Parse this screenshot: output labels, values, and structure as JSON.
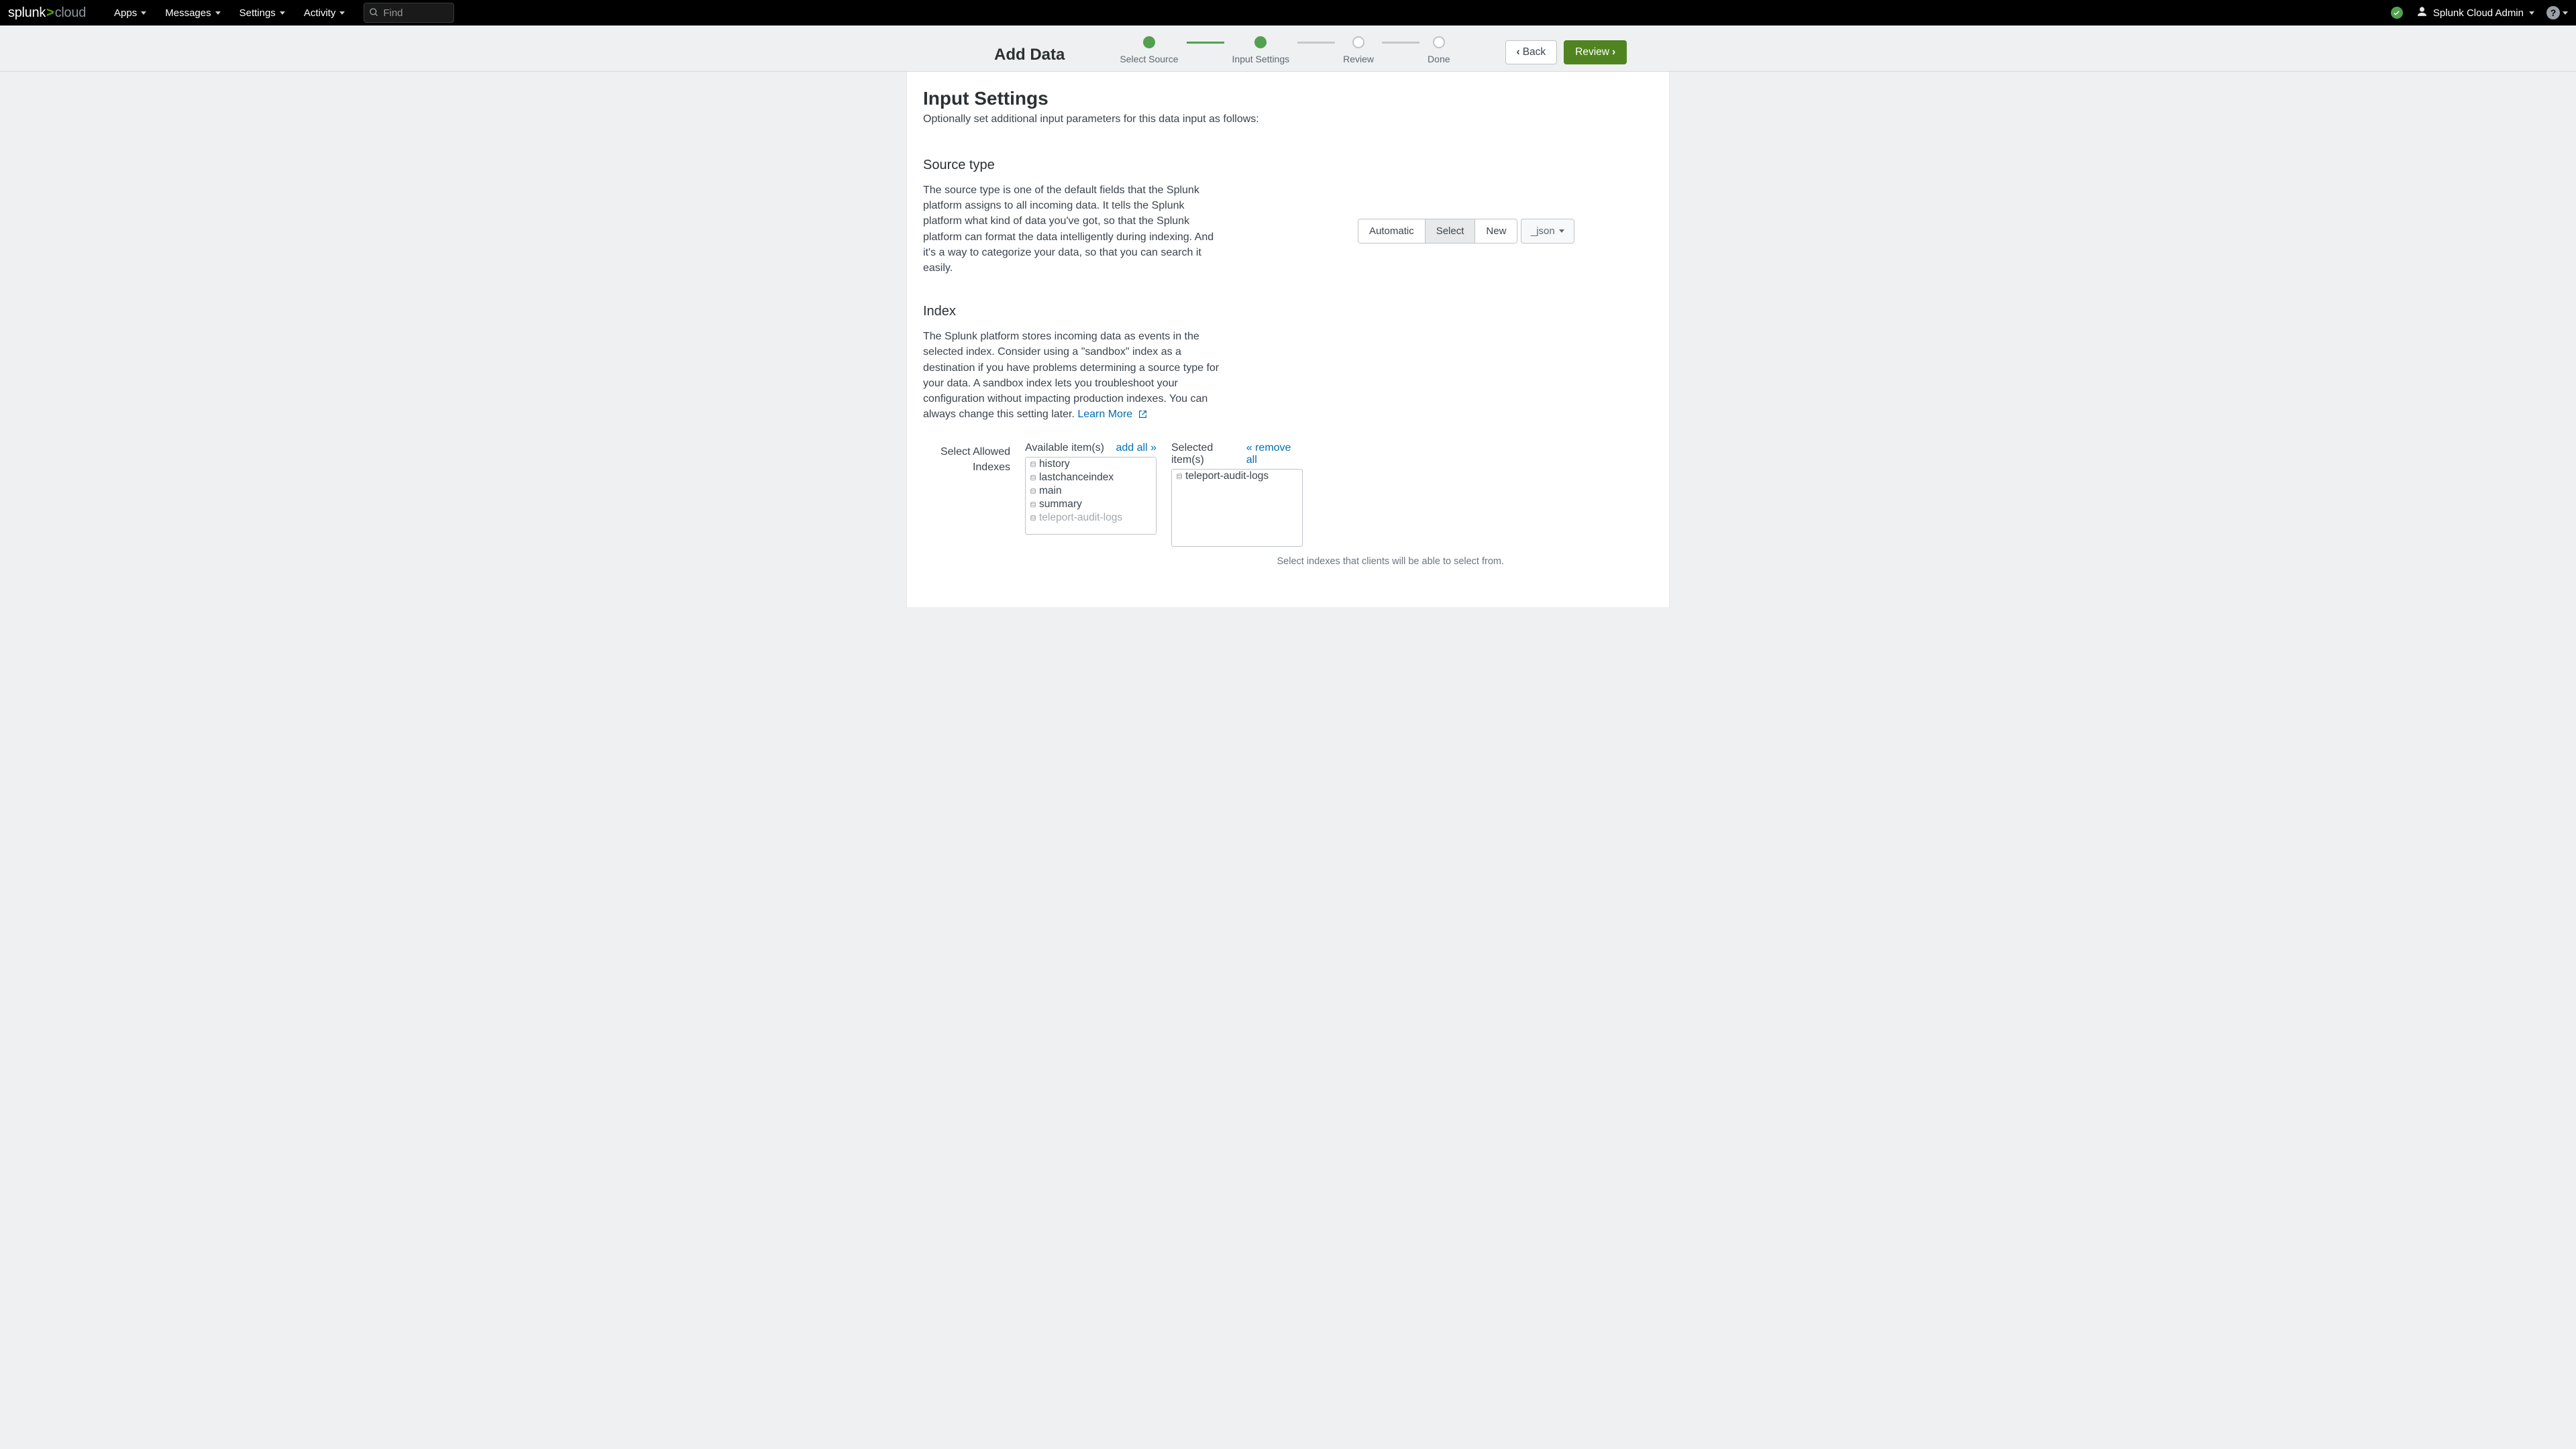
{
  "topnav": {
    "logo": {
      "splunk": "splunk",
      "gt": ">",
      "cloud": "cloud"
    },
    "items": [
      "Apps",
      "Messages",
      "Settings",
      "Activity"
    ],
    "find_placeholder": "Find",
    "user": "Splunk Cloud Admin"
  },
  "wizard": {
    "title": "Add Data",
    "steps": [
      "Select Source",
      "Input Settings",
      "Review",
      "Done"
    ],
    "active_index": 1,
    "back": "Back",
    "review": "Review"
  },
  "page": {
    "heading": "Input Settings",
    "sub": "Optionally set additional input parameters for this data input as follows:"
  },
  "sourcetype": {
    "heading": "Source type",
    "body": "The source type is one of the default fields that the Splunk platform assigns to all incoming data. It tells the Splunk platform what kind of data you've got, so that the Splunk platform can format the data intelligently during indexing. And it's a way to categorize your data, so that you can search it easily.",
    "seg": {
      "auto": "Automatic",
      "select": "Select",
      "new": "New"
    },
    "selected_value": "_json"
  },
  "index": {
    "heading": "Index",
    "body": "The Splunk platform stores incoming data as events in the selected index. Consider using a \"sandbox\" index as a destination if you have problems determining a source type for your data. A sandbox index lets you troubleshoot your configuration without impacting production indexes. You can always change this setting later. ",
    "learn_more": "Learn More",
    "picker_label_l1": "Select Allowed",
    "picker_label_l2": "Indexes",
    "available_label": "Available item(s)",
    "add_all": "add all »",
    "selected_label": "Selected item(s)",
    "remove_all": "« remove all",
    "available": [
      "history",
      "lastchanceindex",
      "main",
      "summary",
      "teleport-audit-logs"
    ],
    "available_disabled_last": true,
    "selected": [
      "teleport-audit-logs"
    ],
    "footer": "Select indexes that clients will be able to select from."
  },
  "colors": {
    "accent": "#53a051",
    "primary_btn": "#508420",
    "link": "#006eb3"
  }
}
